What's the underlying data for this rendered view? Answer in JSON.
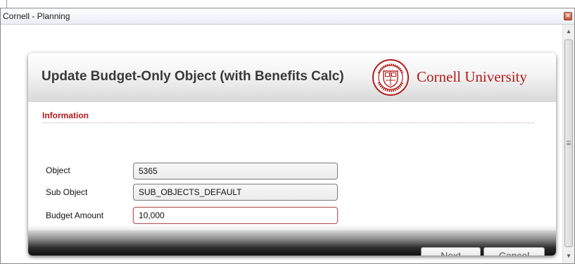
{
  "window": {
    "title": "Cornell - Planning"
  },
  "dialog": {
    "title": "Update Budget-Only Object (with Benefits Calc)",
    "brand": "Cornell University",
    "seal_text_top": "CORNELL UNIVERSITY",
    "seal_text_bottom": "FOUNDED A.D. 1865"
  },
  "section": {
    "title": "Information"
  },
  "fields": [
    {
      "label": "Object",
      "value": "5365"
    },
    {
      "label": "Sub Object",
      "value": "SUB_OBJECTS_DEFAULT"
    },
    {
      "label": "Budget Amount",
      "value": "10,000"
    }
  ],
  "buttons": {
    "next": "Next",
    "cancel": "Cancel"
  },
  "colors": {
    "brand_red": "#b31b1b",
    "title_gray": "#3a3a3a"
  }
}
